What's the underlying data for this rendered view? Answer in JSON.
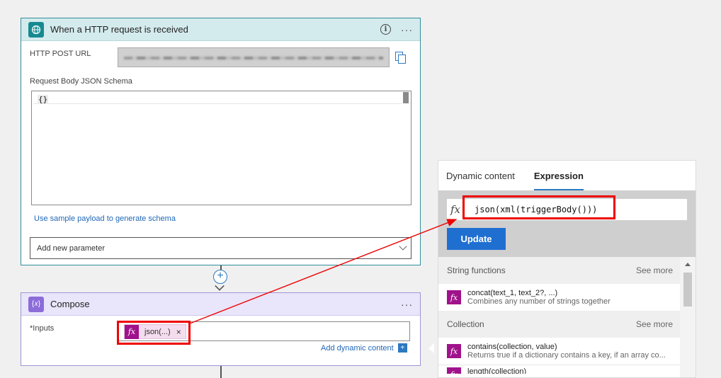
{
  "http_trigger": {
    "title": "When a HTTP request is received",
    "url_label": "HTTP POST URL",
    "schema_label": "Request Body JSON Schema",
    "schema_value": "{}",
    "sample_payload_link": "Use sample payload to generate schema",
    "add_parameter_placeholder": "Add new parameter",
    "more_label": "···"
  },
  "compose": {
    "title": "Compose",
    "icon_text": "{𝑥}",
    "inputs_label": "*Inputs",
    "token_label": "json(...)",
    "token_remove": "×",
    "add_dynamic_content": "Add dynamic content",
    "more_label": "···"
  },
  "panel": {
    "tabs": [
      "Dynamic content",
      "Expression"
    ],
    "active_tab": "Expression",
    "expression_value": "json(xml(triggerBody()))",
    "update_label": "Update",
    "sections": [
      {
        "title": "String functions",
        "see_more": "See more",
        "items": [
          {
            "name": "concat(text_1, text_2?, ...)",
            "desc": "Combines any number of strings together"
          }
        ]
      },
      {
        "title": "Collection",
        "see_more": "See more",
        "items": [
          {
            "name": "contains(collection, value)",
            "desc": "Returns true if a dictionary contains a key, if an array co..."
          },
          {
            "name": "length(collection)",
            "desc": ""
          }
        ]
      }
    ]
  },
  "icons": {
    "fx": "fx",
    "globe": "globe-icon",
    "copy": "copy-icon",
    "info": "i",
    "plus": "+",
    "add_dyn": "+"
  },
  "colors": {
    "accent": "#1f6fd1",
    "fx_badge": "#a0128b",
    "highlight": "#e00000",
    "trigger_header": "#d4ebed",
    "compose_header": "#e9e5fa"
  }
}
